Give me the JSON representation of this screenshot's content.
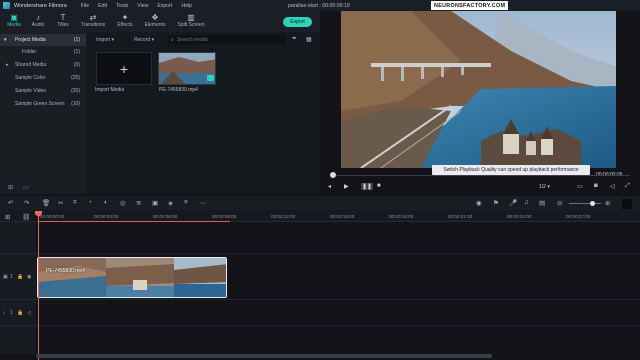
{
  "app": {
    "name": "Wondershare Filmora",
    "menu": [
      "File",
      "Edit",
      "Tools",
      "View",
      "Export",
      "Help"
    ],
    "project_title": "parallax-start : 00:00:09:19",
    "brand_badge": "NEURONSFACTORY.COM"
  },
  "toolbar": {
    "tabs": [
      {
        "label": "Media",
        "icon": "folder-icon",
        "active": true
      },
      {
        "label": "Audio",
        "icon": "music-icon"
      },
      {
        "label": "Titles",
        "icon": "text-icon"
      },
      {
        "label": "Transitions",
        "icon": "transition-icon"
      },
      {
        "label": "Effects",
        "icon": "effects-icon"
      },
      {
        "label": "Elements",
        "icon": "elements-icon"
      },
      {
        "label": "Split Screen",
        "icon": "split-screen-icon"
      }
    ],
    "export_label": "Export"
  },
  "sidebar": {
    "items": [
      {
        "label": "Project Media",
        "count": "(1)",
        "active": true
      },
      {
        "label": "Folder",
        "count": "(1)"
      },
      {
        "label": "Shared Media",
        "count": "(0)"
      },
      {
        "label": "Sample Color",
        "count": "(25)"
      },
      {
        "label": "Sample Video",
        "count": "(20)"
      },
      {
        "label": "Sample Green Screen",
        "count": "(10)"
      }
    ]
  },
  "media": {
    "import_label": "Import",
    "record_label": "Record",
    "search_placeholder": "Search media",
    "import_tile_label": "Import Media",
    "clip_label": "PE-7455830.mp4"
  },
  "player": {
    "tooltip": "Switch Playback Quality can speed up playback performance",
    "timecode": "00:00:00:06",
    "quality": "1/2",
    "progress_fraction": 0.01
  },
  "timeline": {
    "ruler_labels": [
      "00:00:00:00",
      "00:00:03:00",
      "00:00:06:00",
      "00:00:09:00",
      "00:00:12:00",
      "00:00:15:00",
      "00:00:18:00",
      "00:00:21:00",
      "00:00:24:00",
      "00:00:27:00"
    ],
    "clip_name": "PE-7455830.mp4",
    "video_track_label": "1",
    "audio_track_label": "1"
  },
  "colors": {
    "accent": "#2fd3c2",
    "playhead": "#f06464",
    "export_bg": "#2fd3b8"
  }
}
